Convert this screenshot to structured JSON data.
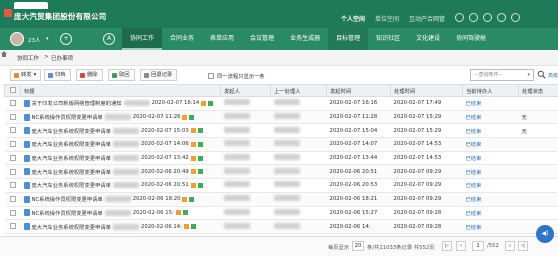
{
  "header": {
    "company": "庞大汽贸集团股份有限公司",
    "top_nav": [
      "个人空间",
      "单位空间",
      "互动产合网管"
    ]
  },
  "user": {
    "name": "23人"
  },
  "nav": {
    "home_glyph": "A",
    "tabs": [
      "协同工作",
      "合同业务",
      "表单应用",
      "会议管理",
      "业务生成器",
      "目标管理",
      "知识社区",
      "文化建设",
      "协同驾驶舱"
    ],
    "active_tab": "协同工作"
  },
  "breadcrumb": {
    "parent": "协同工作",
    "separator": ">",
    "current": "已办事项"
  },
  "toolbar": {
    "forward": "转发",
    "archive": "归档",
    "delete": "删除",
    "takeback": "取回",
    "history": "回退记录",
    "same_flow_only": "同一流程只显示一条",
    "query_placeholder": "--查询条件--",
    "advanced": "高级"
  },
  "table": {
    "headers": [
      "标题",
      "发起人",
      "上一处理人",
      "发起时间",
      "处理时间",
      "当前待办人",
      "处理状态"
    ],
    "rows": [
      {
        "title": "关于印发公司新版网络管理制度的通知",
        "time_in_title": "2020-02-07 16:14",
        "sender": "",
        "prev": "",
        "start": "2020-02-07 16:16",
        "done": "2020-02-07 17:49",
        "todo": "已结束",
        "status": ""
      },
      {
        "title": "NC系统操作员权限变更申请单",
        "time_in_title": "2020-02-07 11:26",
        "sender": "",
        "prev": "",
        "start": "2020-02-07 11:28",
        "done": "2020-02-07 15:29",
        "todo": "已结束",
        "status": "无"
      },
      {
        "title": "庞大汽车业务系统权限变更申请单",
        "time_in_title": "2020-02-07 15:03",
        "sender": "",
        "prev": "",
        "start": "2020-02-07 15:04",
        "done": "2020-02-07 15:29",
        "todo": "已结束",
        "status": "无"
      },
      {
        "title": "庞大汽车业务系统权限变更申请单",
        "time_in_title": "2020-02-07 14:06",
        "sender": "",
        "prev": "",
        "start": "2020-02-07 14:07",
        "done": "2020-02-07 14:53",
        "todo": "已结束",
        "status": ""
      },
      {
        "title": "庞大汽车业务系统权限变更申请单",
        "time_in_title": "2020-02-07 13:42",
        "sender": "",
        "prev": "",
        "start": "2020-02-07 13:44",
        "done": "2020-02-07 14:53",
        "todo": "已结束",
        "status": ""
      },
      {
        "title": "庞大汽车业务系统权限变更申请单",
        "time_in_title": "2020-02-06 20:49",
        "sender": "",
        "prev": "",
        "start": "2020-02-06 20:51",
        "done": "2020-02-07 09:29",
        "todo": "已结束",
        "status": ""
      },
      {
        "title": "庞大汽车业务系统权限变更申请单",
        "time_in_title": "2020-02-06 20:51",
        "sender": "",
        "prev": "",
        "start": "2020-02-06 20:53",
        "done": "2020-02-07 09:29",
        "todo": "已结束",
        "status": ""
      },
      {
        "title": "NC系统操作员权限变更申请单",
        "time_in_title": "2020-02-06 18:20",
        "sender": "",
        "prev": "",
        "start": "2020-02-06 18:21",
        "done": "2020-02-07 09:29",
        "todo": "已结束",
        "status": ""
      },
      {
        "title": "NC系统操作员权限变更申请单",
        "time_in_title": "2020-02-06 15:",
        "sender": "",
        "prev": "",
        "start": "2020-02-06 15:27",
        "done": "2020-02-07 09:28",
        "todo": "已结束",
        "status": ""
      },
      {
        "title": "庞大汽车业务系统权限变更申请单",
        "time_in_title": "2020-02-06 14:",
        "sender": "",
        "prev": "",
        "start": "2020-02-06 14:",
        "done": "2020-02-07 09:28",
        "todo": "已结束",
        "status": ""
      }
    ]
  },
  "pager": {
    "per_page_label": "每页显示",
    "per_page": "20",
    "summary": "条/共11033条记录 共552页",
    "page": "1",
    "total_pages": "/552"
  },
  "colors": {
    "topbar": "#1f7a59",
    "navbar": "#2b8a66",
    "link": "#2a6fb8"
  }
}
